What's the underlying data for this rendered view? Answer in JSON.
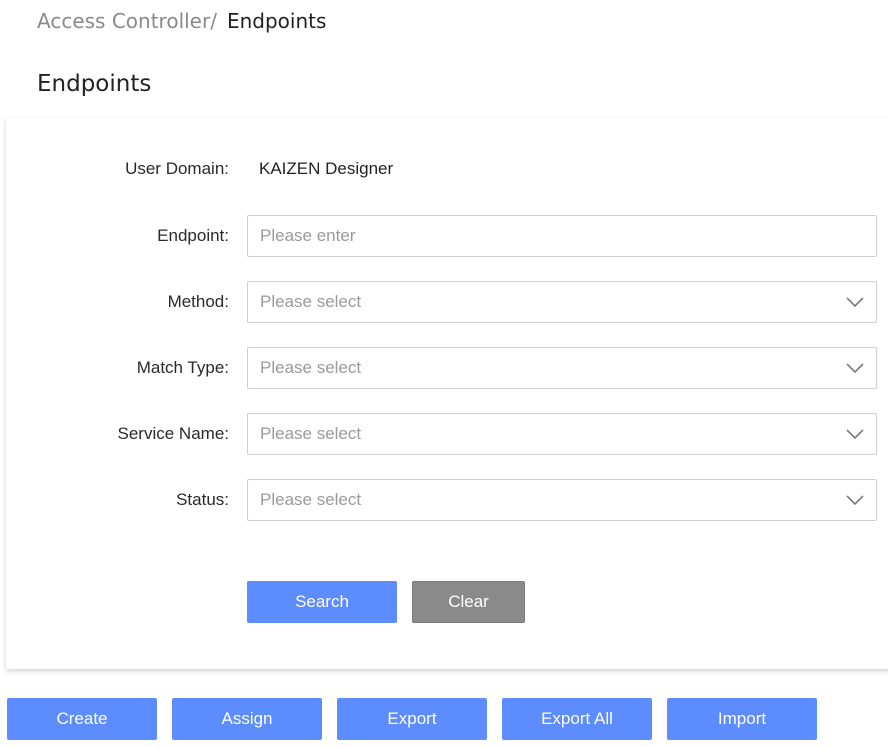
{
  "breadcrumb": {
    "parent": "Access Controller/",
    "current": "Endpoints"
  },
  "page_title": "Endpoints",
  "form": {
    "user_domain": {
      "label": "User Domain:",
      "value": "KAIZEN Designer"
    },
    "endpoint": {
      "label": "Endpoint:",
      "placeholder": "Please enter"
    },
    "method": {
      "label": "Method:",
      "placeholder": "Please select"
    },
    "match_type": {
      "label": "Match Type:",
      "placeholder": "Please select"
    },
    "service_name": {
      "label": "Service Name:",
      "placeholder": "Please select"
    },
    "status": {
      "label": "Status:",
      "placeholder": "Please select"
    }
  },
  "buttons": {
    "search": "Search",
    "clear": "Clear"
  },
  "actions": {
    "create": "Create",
    "assign": "Assign",
    "export": "Export",
    "export_all": "Export All",
    "import": "Import"
  },
  "colors": {
    "primary": "#5d8cff",
    "secondary": "#8a8a8a"
  },
  "icons": {
    "dropdown": "chevron-down-icon"
  }
}
